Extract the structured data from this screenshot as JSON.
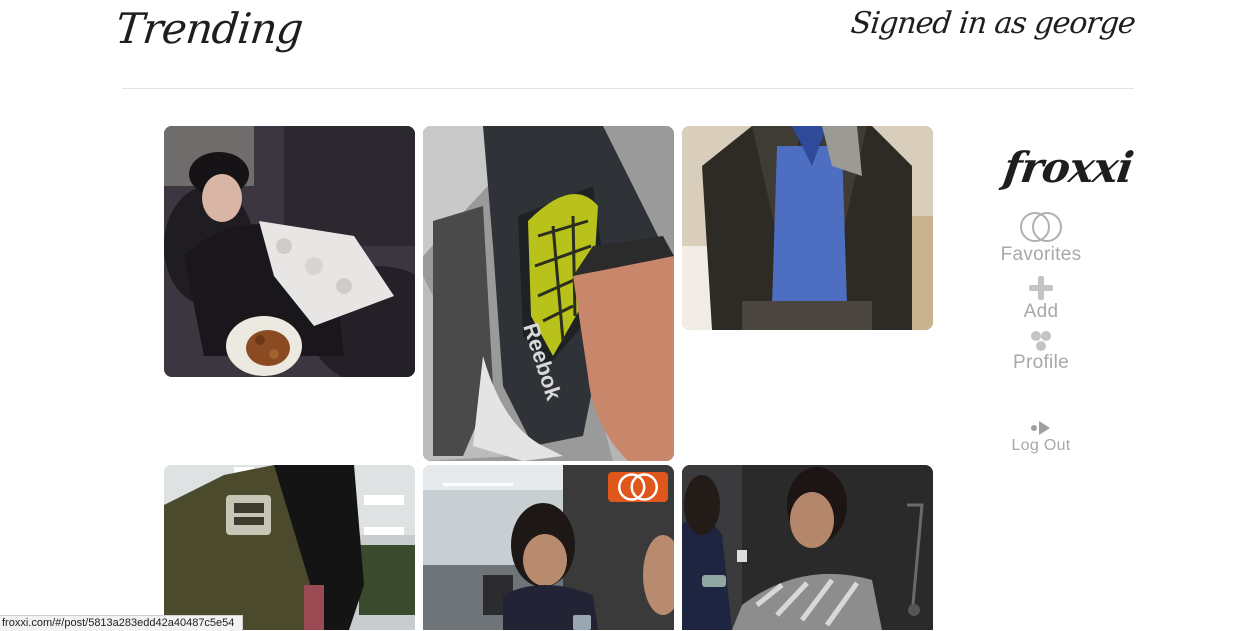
{
  "header": {
    "title": "Trending",
    "signed_in": "Signed in as george"
  },
  "sidebar": {
    "brand": "froxxi",
    "nav": {
      "favorites": "Favorites",
      "add": "Add",
      "profile": "Profile",
      "logout": "Log Out"
    }
  },
  "posts": [
    {
      "id": 1,
      "subject": "person-resting-on-couch"
    },
    {
      "id": 2,
      "subject": "reebok-sneaker",
      "shoe_text": "Reebok"
    },
    {
      "id": 3,
      "subject": "leather-jacket-selfie"
    },
    {
      "id": 4,
      "subject": "olive-bomber-jacket"
    },
    {
      "id": 5,
      "subject": "woman-looking-at-phone",
      "favorited": true
    },
    {
      "id": 6,
      "subject": "woman-holding-phone"
    }
  ],
  "status_bar": {
    "url": "froxxi.com/#/post/5813a283edd42a40487c5e54"
  },
  "colors": {
    "favorite_badge": "#e0571c",
    "nav_text": "#a8a8a8",
    "divider": "#e3e3e3"
  }
}
